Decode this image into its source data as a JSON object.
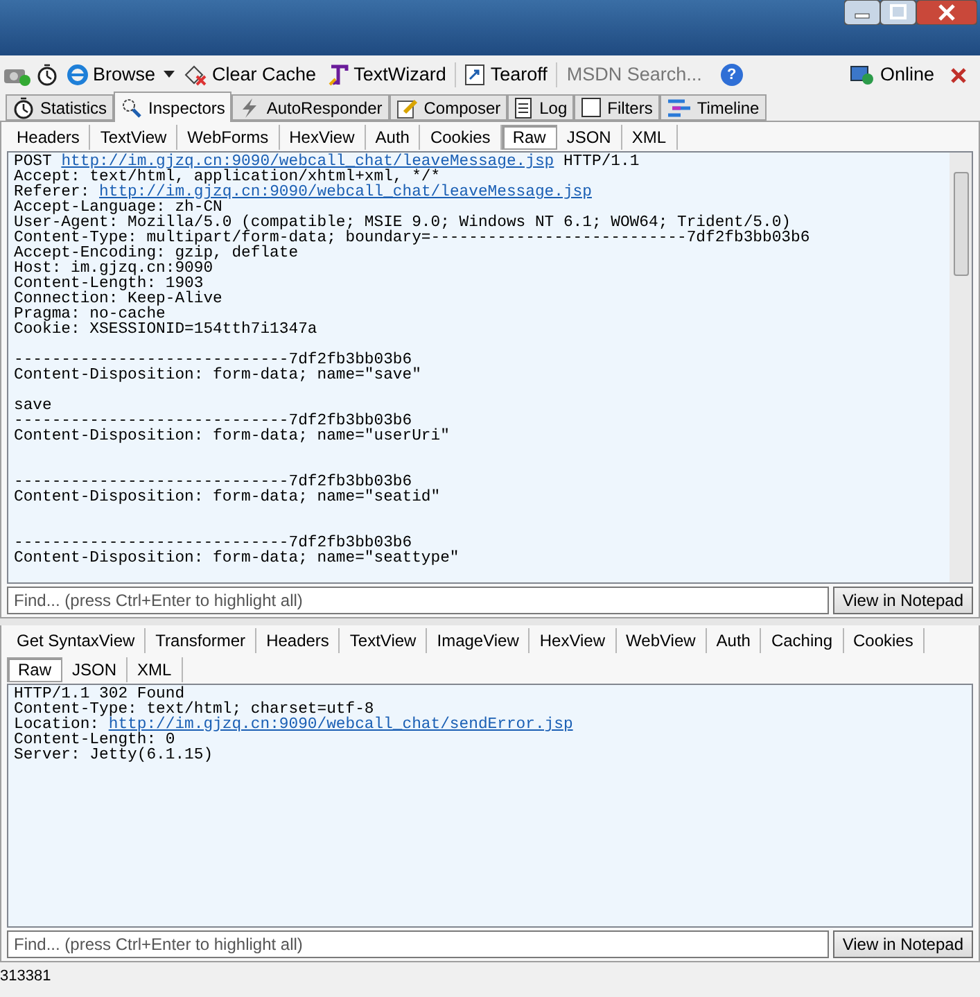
{
  "window_controls": [
    {
      "kind": "minimize"
    },
    {
      "kind": "maximize"
    },
    {
      "kind": "close"
    }
  ],
  "toolbar": [
    {
      "kind": "camera"
    },
    {
      "kind": "timer"
    },
    {
      "kind": "browse",
      "label": "Browse"
    },
    {
      "kind": "caret"
    },
    {
      "kind": "clear",
      "label": "Clear Cache"
    },
    {
      "kind": "wizard",
      "label": "TextWizard"
    },
    {
      "kind": "tearoff",
      "label": "Tearoff"
    }
  ],
  "search": {
    "placeholder": "MSDN Search..."
  },
  "help": {
    "label": "?"
  },
  "online": {
    "label": "Online"
  },
  "main_tabs": [
    {
      "label": "Statistics",
      "selected": false
    },
    {
      "label": "Inspectors",
      "selected": true
    },
    {
      "label": "AutoResponder",
      "selected": false
    },
    {
      "label": "Composer",
      "selected": false
    },
    {
      "label": "Log",
      "selected": false
    },
    {
      "label": "Filters",
      "selected": false
    },
    {
      "label": "Timeline",
      "selected": false
    }
  ],
  "request": {
    "tabs": [
      {
        "label": "Headers",
        "selected": false
      },
      {
        "label": "TextView",
        "selected": false
      },
      {
        "label": "WebForms",
        "selected": false
      },
      {
        "label": "HexView",
        "selected": false
      },
      {
        "label": "Auth",
        "selected": false
      },
      {
        "label": "Cookies",
        "selected": false
      },
      {
        "label": "Raw",
        "selected": true
      },
      {
        "label": "JSON",
        "selected": false
      },
      {
        "label": "XML",
        "selected": false
      }
    ],
    "lines": [
      {
        "kind": "text",
        "parts": [
          {
            "text": "POST ",
            "link": false
          },
          {
            "text": "http://im.gjzq.cn:9090/webcall_chat/leaveMessage.jsp",
            "link": true
          },
          {
            "text": " HTTP/1.1",
            "link": false
          }
        ]
      },
      {
        "kind": "text",
        "parts": [
          {
            "text": "Accept: text/html, application/xhtml+xml, */*",
            "link": false
          }
        ]
      },
      {
        "kind": "text",
        "parts": [
          {
            "text": "Referer: ",
            "link": false
          },
          {
            "text": "http://im.gjzq.cn:9090/webcall_chat/leaveMessage.jsp",
            "link": true
          }
        ]
      },
      {
        "kind": "text",
        "parts": [
          {
            "text": "Accept-Language: zh-CN",
            "link": false
          }
        ]
      },
      {
        "kind": "text",
        "parts": [
          {
            "text": "User-Agent: Mozilla/5.0 (compatible; MSIE 9.0; Windows NT 6.1; WOW64; Trident/5.0)",
            "link": false
          }
        ]
      },
      {
        "kind": "text",
        "parts": [
          {
            "text": "Content-Type: multipart/form-data; boundary=---------------------------7df2fb3bb03b6",
            "link": false
          }
        ]
      },
      {
        "kind": "text",
        "parts": [
          {
            "text": "Accept-Encoding: gzip, deflate",
            "link": false
          }
        ]
      },
      {
        "kind": "text",
        "parts": [
          {
            "text": "Host: im.gjzq.cn:9090",
            "link": false
          }
        ]
      },
      {
        "kind": "text",
        "parts": [
          {
            "text": "Content-Length: 1903",
            "link": false
          }
        ]
      },
      {
        "kind": "text",
        "parts": [
          {
            "text": "Connection: Keep-Alive",
            "link": false
          }
        ]
      },
      {
        "kind": "text",
        "parts": [
          {
            "text": "Pragma: no-cache",
            "link": false
          }
        ]
      },
      {
        "kind": "text",
        "parts": [
          {
            "text": "Cookie: XSESSIONID=154tth7i1347a",
            "link": false
          }
        ]
      },
      {
        "kind": "blank"
      },
      {
        "kind": "text",
        "parts": [
          {
            "text": "-----------------------------7df2fb3bb03b6",
            "link": false
          }
        ]
      },
      {
        "kind": "text",
        "parts": [
          {
            "text": "Content-Disposition: form-data; name=\"save\"",
            "link": false
          }
        ]
      },
      {
        "kind": "blank"
      },
      {
        "kind": "text",
        "parts": [
          {
            "text": "save",
            "link": false
          }
        ]
      },
      {
        "kind": "text",
        "parts": [
          {
            "text": "-----------------------------7df2fb3bb03b6",
            "link": false
          }
        ]
      },
      {
        "kind": "text",
        "parts": [
          {
            "text": "Content-Disposition: form-data; name=\"userUri\"",
            "link": false
          }
        ]
      },
      {
        "kind": "blank"
      },
      {
        "kind": "blank"
      },
      {
        "kind": "text",
        "parts": [
          {
            "text": "-----------------------------7df2fb3bb03b6",
            "link": false
          }
        ]
      },
      {
        "kind": "text",
        "parts": [
          {
            "text": "Content-Disposition: form-data; name=\"seatid\"",
            "link": false
          }
        ]
      },
      {
        "kind": "blank"
      },
      {
        "kind": "blank"
      },
      {
        "kind": "text",
        "parts": [
          {
            "text": "-----------------------------7df2fb3bb03b6",
            "link": false
          }
        ]
      },
      {
        "kind": "text",
        "parts": [
          {
            "text": "Content-Disposition: form-data; name=\"seattype\"",
            "link": false
          }
        ]
      }
    ],
    "find": {
      "placeholder": "Find... (press Ctrl+Enter to highlight all)"
    },
    "notepad_button": "View in Notepad"
  },
  "response": {
    "tabs": [
      {
        "label": "Get SyntaxView",
        "selected": false
      },
      {
        "label": "Transformer",
        "selected": false
      },
      {
        "label": "Headers",
        "selected": false
      },
      {
        "label": "TextView",
        "selected": false
      },
      {
        "label": "ImageView",
        "selected": false
      },
      {
        "label": "HexView",
        "selected": false
      },
      {
        "label": "WebView",
        "selected": false
      },
      {
        "label": "Auth",
        "selected": false
      },
      {
        "label": "Caching",
        "selected": false
      },
      {
        "label": "Cookies",
        "selected": false
      }
    ],
    "tabs_row2": [
      {
        "label": "Raw",
        "selected": true
      },
      {
        "label": "JSON",
        "selected": false
      },
      {
        "label": "XML",
        "selected": false
      }
    ],
    "lines": [
      {
        "kind": "text",
        "parts": [
          {
            "text": "HTTP/1.1 302 Found",
            "link": false
          }
        ]
      },
      {
        "kind": "text",
        "parts": [
          {
            "text": "Content-Type: text/html; charset=utf-8",
            "link": false
          }
        ]
      },
      {
        "kind": "text",
        "parts": [
          {
            "text": "Location: ",
            "link": false
          },
          {
            "text": "http://im.gjzq.cn:9090/webcall_chat/sendError.jsp",
            "link": true
          }
        ]
      },
      {
        "kind": "text",
        "parts": [
          {
            "text": "Content-Length: 0",
            "link": false
          }
        ]
      },
      {
        "kind": "text",
        "parts": [
          {
            "text": "Server: Jetty(6.1.15)",
            "link": false
          }
        ]
      }
    ],
    "find": {
      "placeholder": "Find... (press Ctrl+Enter to highlight all)"
    },
    "notepad_button": "View in Notepad"
  },
  "status_bar": {
    "text": "313381"
  }
}
